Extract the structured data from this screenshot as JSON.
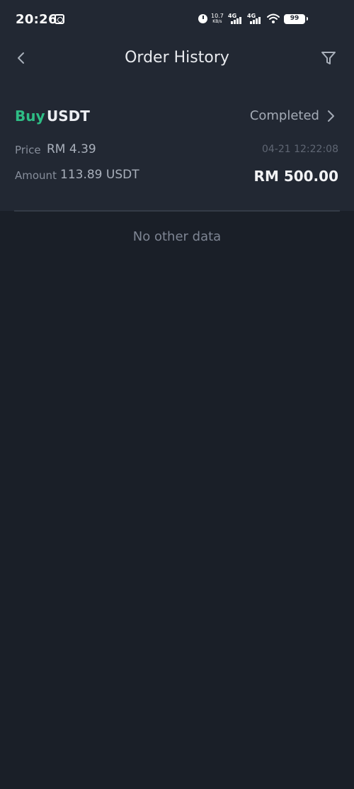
{
  "status_bar": {
    "time": "20:26",
    "net_speed_value": "10.7",
    "net_speed_unit": "KB/s",
    "sim1_label": "4G",
    "sim2_label": "4G",
    "battery_level": "99",
    "icons": [
      "app-icon",
      "alarm-icon",
      "signal-icon",
      "wifi-icon",
      "battery-icon"
    ]
  },
  "header": {
    "title": "Order History",
    "back_icon": "chevron-left-icon",
    "filter_icon": "filter-icon"
  },
  "orders": [
    {
      "side": "Buy",
      "asset": "USDT",
      "status": "Completed",
      "price_label": "Price",
      "price_value": "RM 4.39",
      "time": "04-21 12:22:08",
      "amount_label": "Amount",
      "amount_value": "113.89 USDT",
      "total": "RM 500.00"
    }
  ],
  "empty_message": "No other data",
  "colors": {
    "background": "#1a1f28",
    "header_background": "#222833",
    "buy_green": "#2ebd85",
    "muted_text": "#878e9b"
  }
}
